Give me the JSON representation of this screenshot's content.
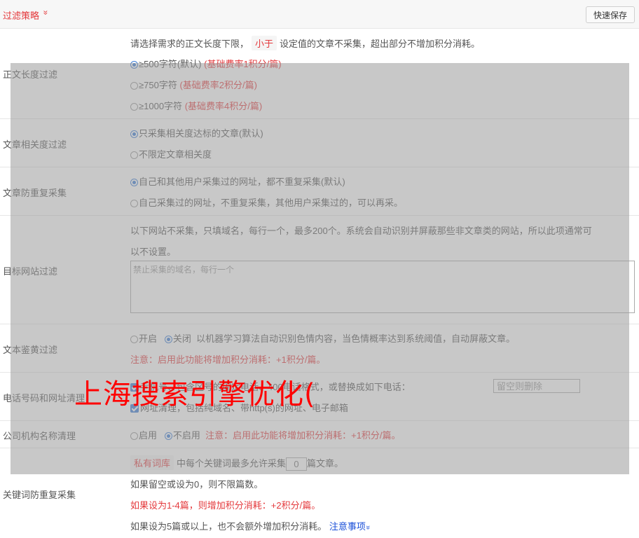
{
  "header": {
    "title": "过滤策略",
    "chevron": "»",
    "save_label": "快速保存"
  },
  "length_filter": {
    "label": "正文长度过滤",
    "desc_prefix": "请选择需求的正文长度下限，",
    "desc_tag": "小于",
    "desc_suffix": "设定值的文章不采集，超出部分不增加积分消耗。",
    "options": [
      {
        "label": "≥500字符(默认)",
        "note": "(基础费率1积分/篇)",
        "selected": true
      },
      {
        "label": "≥750字符",
        "note": "(基础费率2积分/篇)",
        "selected": false
      },
      {
        "label": "≥1000字符",
        "note": "(基础费率4积分/篇)",
        "selected": false
      }
    ]
  },
  "relevance_filter": {
    "label": "文章相关度过滤",
    "options": [
      {
        "label": "只采集相关度达标的文章(默认)",
        "selected": true
      },
      {
        "label": "不限定文章相关度",
        "selected": false
      }
    ]
  },
  "duplicate_filter": {
    "label": "文章防重复采集",
    "options": [
      {
        "label": "自己和其他用户采集过的网址，都不重复采集(默认)",
        "selected": true
      },
      {
        "label": "自己采集过的网址，不重复采集，其他用户采集过的，可以再采。",
        "selected": false
      }
    ]
  },
  "site_filter": {
    "label": "目标网站过滤",
    "desc_line1": "以下网站不采集，只填域名，每行一个，最多200个。系统会自动识别并屏蔽那些非文章类的网站，所以此项通常可",
    "desc_line2": "以不设置。",
    "placeholder": "禁止采集的域名，每行一个"
  },
  "porn_filter": {
    "label": "文本鉴黄过滤",
    "on_label": "开启",
    "off_label": "关闭",
    "selected": "off",
    "desc": "以机器学习算法自动识别色情内容，当色情概率达到系统阈值，自动屏蔽文章。",
    "warning": "注意：启用此功能将增加积分消耗：+1积分/篇。"
  },
  "phone_filter": {
    "label": "电话号码和网址清理",
    "line1_text": "手机号、包含区号的固定电话、400电话格式，或替换成如下电话：",
    "phone_placeholder": "留空则删除",
    "line2_text": "网址清理，包括纯域名、带http(s)的网址、电子邮箱",
    "line1_checked": true,
    "line2_checked": true
  },
  "org_filter": {
    "label": "公司机构名称清理",
    "on_label": "启用",
    "off_label": "不启用",
    "selected": "off",
    "warning": "注意：启用此功能将增加积分消耗：+1积分/篇。"
  },
  "keyword_filter": {
    "label": "关键词防重复采集",
    "tag": "私有词库",
    "text_a": "中每个关键词最多允许采集",
    "value": "0",
    "text_b": "篇文章。",
    "line2": "如果留空或设为0，则不限篇数。",
    "line3": "如果设为1-4篇，则增加积分消耗：+2积分/篇。",
    "line4": "如果设为5篇或以上，也不会额外增加积分消耗。",
    "link": "注意事项",
    "link_chevron": "»"
  },
  "watermark": {
    "text": "上海搜索引擎优化("
  },
  "colors": {
    "accent": "#e4393c",
    "link": "#1a4fd8",
    "radio": "#3b7dd8",
    "overlay": "#9b9b9b"
  }
}
